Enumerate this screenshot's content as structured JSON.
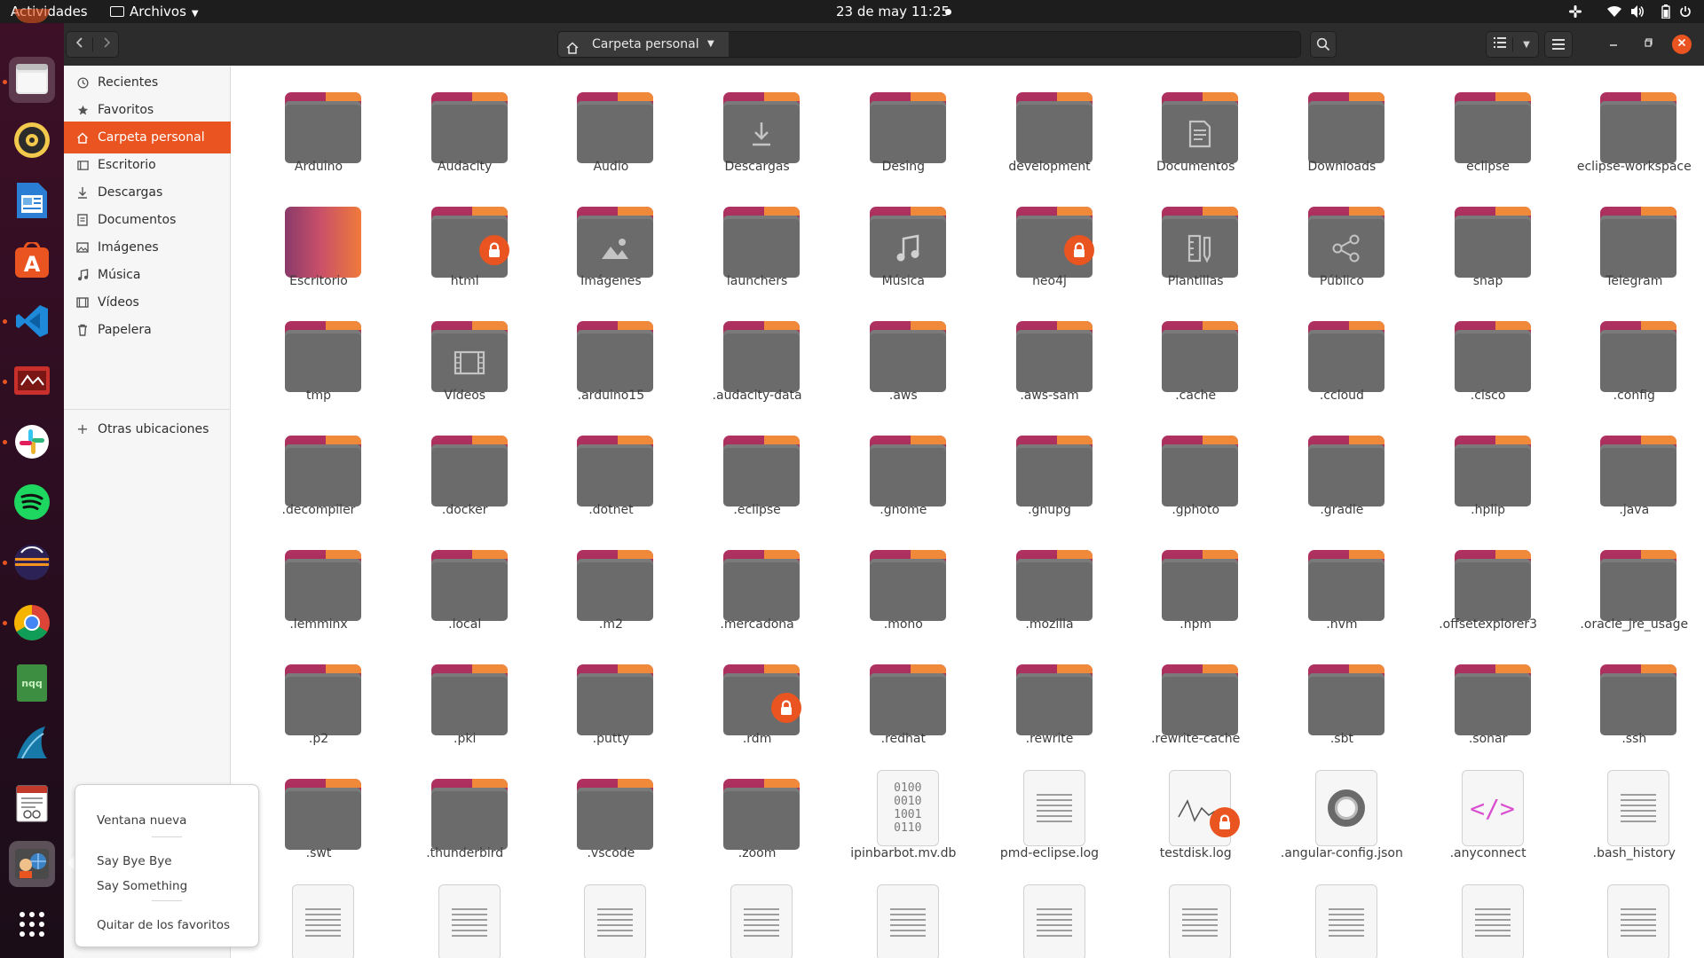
{
  "topbar": {
    "activities": "Actividades",
    "app_menu": "Archivos",
    "clock": "23 de may  11:25"
  },
  "dock": {
    "apps": [
      {
        "name": "files",
        "active": true,
        "running": true
      },
      {
        "name": "rhythmbox",
        "active": false,
        "running": false
      },
      {
        "name": "libreoffice-writer",
        "active": false,
        "running": false
      },
      {
        "name": "software-center",
        "active": false,
        "running": false
      },
      {
        "name": "vscode",
        "active": false,
        "running": true
      },
      {
        "name": "remote-desktop",
        "active": false,
        "running": true
      },
      {
        "name": "slack",
        "active": false,
        "running": true
      },
      {
        "name": "spotify",
        "active": false,
        "running": false
      },
      {
        "name": "eclipse",
        "active": false,
        "running": true
      },
      {
        "name": "chrome",
        "active": false,
        "running": true
      },
      {
        "name": "nqq",
        "active": false,
        "running": false
      },
      {
        "name": "wireshark",
        "active": false,
        "running": false
      },
      {
        "name": "document-viewer",
        "active": false,
        "running": false
      },
      {
        "name": "say-something-app",
        "active": true,
        "running": false
      }
    ],
    "nqq_label": "nqq"
  },
  "headerbar": {
    "location": "Carpeta personal"
  },
  "sidebar": {
    "items": [
      {
        "label": "Recientes",
        "icon": "clock-icon"
      },
      {
        "label": "Favoritos",
        "icon": "star-icon"
      },
      {
        "label": "Carpeta personal",
        "icon": "home-icon",
        "selected": true
      },
      {
        "label": "Escritorio",
        "icon": "desktop-icon"
      },
      {
        "label": "Descargas",
        "icon": "download-icon"
      },
      {
        "label": "Documentos",
        "icon": "document-icon"
      },
      {
        "label": "Imágenes",
        "icon": "image-icon"
      },
      {
        "label": "Música",
        "icon": "music-icon"
      },
      {
        "label": "Vídeos",
        "icon": "video-icon"
      },
      {
        "label": "Papelera",
        "icon": "trash-icon"
      }
    ],
    "other_locations": "Otras ubicaciones"
  },
  "context_menu": {
    "new_window": "Ventana nueva",
    "say_bye": "Say Bye Bye",
    "say_something": "Say Something",
    "remove_favorite": "Quitar de los favoritos"
  },
  "files": [
    {
      "name": "Arduino",
      "kind": "folder"
    },
    {
      "name": "Audacity",
      "kind": "folder"
    },
    {
      "name": "Audio",
      "kind": "folder"
    },
    {
      "name": "Descargas",
      "kind": "folder",
      "emblem": "download"
    },
    {
      "name": "Desing",
      "kind": "folder"
    },
    {
      "name": "development",
      "kind": "folder"
    },
    {
      "name": "Documentos",
      "kind": "folder",
      "emblem": "document"
    },
    {
      "name": "Downloads",
      "kind": "folder"
    },
    {
      "name": "eclipse",
      "kind": "folder"
    },
    {
      "name": "eclipse-workspace",
      "kind": "folder"
    },
    {
      "name": "Escritorio",
      "kind": "desktop"
    },
    {
      "name": "html",
      "kind": "folder",
      "locked": true
    },
    {
      "name": "Imágenes",
      "kind": "folder",
      "emblem": "image"
    },
    {
      "name": "launchers",
      "kind": "folder"
    },
    {
      "name": "Música",
      "kind": "folder",
      "emblem": "music"
    },
    {
      "name": "neo4j",
      "kind": "folder",
      "locked": true
    },
    {
      "name": "Plantillas",
      "kind": "folder",
      "emblem": "template"
    },
    {
      "name": "Público",
      "kind": "folder",
      "emblem": "share"
    },
    {
      "name": "snap",
      "kind": "folder"
    },
    {
      "name": "Telegram",
      "kind": "folder"
    },
    {
      "name": "tmp",
      "kind": "folder"
    },
    {
      "name": "Vídeos",
      "kind": "folder",
      "emblem": "video"
    },
    {
      "name": ".arduino15",
      "kind": "folder"
    },
    {
      "name": ".audacity-data",
      "kind": "folder"
    },
    {
      "name": ".aws",
      "kind": "folder"
    },
    {
      "name": ".aws-sam",
      "kind": "folder"
    },
    {
      "name": ".cache",
      "kind": "folder"
    },
    {
      "name": ".ccloud",
      "kind": "folder"
    },
    {
      "name": ".cisco",
      "kind": "folder"
    },
    {
      "name": ".config",
      "kind": "folder"
    },
    {
      "name": ".decompiler",
      "kind": "folder"
    },
    {
      "name": ".docker",
      "kind": "folder"
    },
    {
      "name": ".dotnet",
      "kind": "folder"
    },
    {
      "name": ".eclipse",
      "kind": "folder"
    },
    {
      "name": ".gnome",
      "kind": "folder"
    },
    {
      "name": ".gnupg",
      "kind": "folder"
    },
    {
      "name": ".gphoto",
      "kind": "folder"
    },
    {
      "name": ".gradle",
      "kind": "folder"
    },
    {
      "name": ".hplip",
      "kind": "folder"
    },
    {
      "name": ".java",
      "kind": "folder"
    },
    {
      "name": ".lemminx",
      "kind": "folder"
    },
    {
      "name": ".local",
      "kind": "folder"
    },
    {
      "name": ".m2",
      "kind": "folder"
    },
    {
      "name": ".mercadona",
      "kind": "folder"
    },
    {
      "name": ".mono",
      "kind": "folder"
    },
    {
      "name": ".mozilla",
      "kind": "folder"
    },
    {
      "name": ".npm",
      "kind": "folder"
    },
    {
      "name": ".nvm",
      "kind": "folder"
    },
    {
      "name": ".offsetexplorer3",
      "kind": "folder"
    },
    {
      "name": ".oracle_jre_usage",
      "kind": "folder"
    },
    {
      "name": ".p2",
      "kind": "folder"
    },
    {
      "name": ".pki",
      "kind": "folder"
    },
    {
      "name": ".putty",
      "kind": "folder"
    },
    {
      "name": ".rdm",
      "kind": "folder",
      "locked": true
    },
    {
      "name": ".redhat",
      "kind": "folder"
    },
    {
      "name": ".rewrite",
      "kind": "folder"
    },
    {
      "name": ".rewrite-cache",
      "kind": "folder"
    },
    {
      "name": ".sbt",
      "kind": "folder"
    },
    {
      "name": ".sonar",
      "kind": "folder"
    },
    {
      "name": ".ssh",
      "kind": "folder"
    },
    {
      "name": ".swt",
      "kind": "folder"
    },
    {
      "name": ".thunderbird",
      "kind": "folder"
    },
    {
      "name": ".vscode",
      "kind": "folder"
    },
    {
      "name": ".zoom",
      "kind": "folder"
    },
    {
      "name": "ipinbarbot.mv.db",
      "kind": "binary"
    },
    {
      "name": "pmd-eclipse.log",
      "kind": "text"
    },
    {
      "name": "testdisk.log",
      "kind": "graph",
      "locked": true
    },
    {
      "name": ".angular-config.json",
      "kind": "json"
    },
    {
      "name": ".anyconnect",
      "kind": "code"
    },
    {
      "name": ".bash_history",
      "kind": "text"
    },
    {
      "name": "",
      "kind": "text"
    },
    {
      "name": "",
      "kind": "text"
    },
    {
      "name": "",
      "kind": "text"
    },
    {
      "name": "",
      "kind": "text"
    },
    {
      "name": "",
      "kind": "text"
    },
    {
      "name": "",
      "kind": "text"
    },
    {
      "name": "",
      "kind": "text"
    },
    {
      "name": "",
      "kind": "text"
    },
    {
      "name": "",
      "kind": "text"
    },
    {
      "name": "",
      "kind": "text"
    }
  ],
  "colors": {
    "accent": "#e95420",
    "topbar": "#1d1d1d",
    "headerbar": "#2c2c2c",
    "folder_tab": "#9c2d55",
    "folder_body": "#6b6b6b"
  }
}
